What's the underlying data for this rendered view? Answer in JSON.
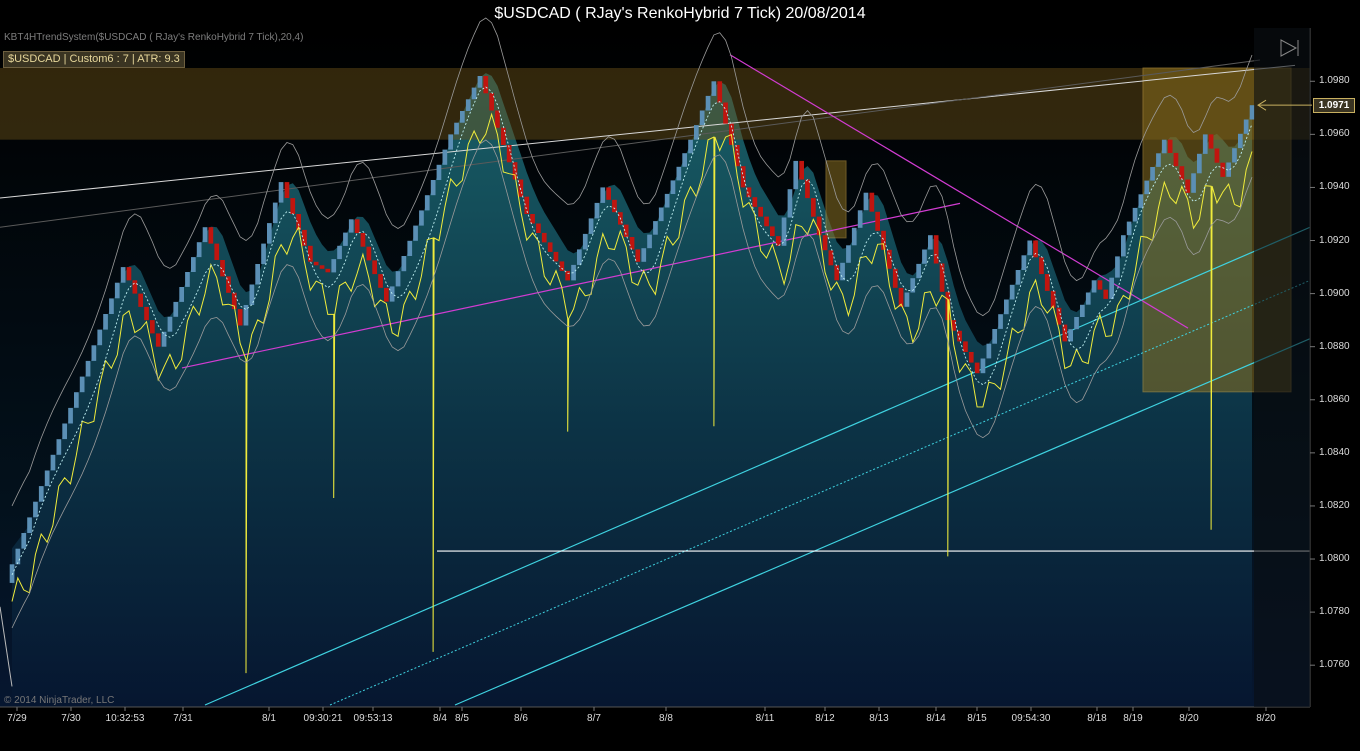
{
  "window": {
    "title": "$USDCAD ( RJay's RenkoHybrid  7 Tick)  20/08/2014"
  },
  "indicator_label": "KBT4HTrendSystem($USDCAD ( RJay's RenkoHybrid  7 Tick),20,4)",
  "info_box": "$USDCAD  |  Custom6 : 7  |  ATR: 9.3",
  "copyright": "© 2014 NinjaTrader, LLC",
  "colors": {
    "background": "#000000",
    "up_bar": "#5b8fb5",
    "down_bar": "#c0150f",
    "yellow_indicator": "#f0ec3c",
    "cyan_channel": "#3fd2e0",
    "magenta_trendline": "#d23cd2",
    "supply_zone": "#6e5418",
    "current_price_label": "#c8b060"
  },
  "icons": {
    "scroll_end": "triangle-right-bar-icon"
  },
  "chart_data": {
    "type": "renko",
    "symbol": "$USDCAD",
    "bar_type": "RJay's RenkoHybrid 7 Tick",
    "date": "20/08/2014",
    "current_price": 1.0971,
    "current_price_label": "1.0971",
    "ylim": [
      1.0745,
      1.0985
    ],
    "yticks": [
      "1.0980",
      "1.0960",
      "1.0940",
      "1.0920",
      "1.0900",
      "1.0880",
      "1.0860",
      "1.0840",
      "1.0820",
      "1.0800",
      "1.0780",
      "1.0760"
    ],
    "xticks": [
      "7/29",
      "7/30",
      "10:32:53",
      "7/31",
      "8/1",
      "09:30:21",
      "09:53:13",
      "8/4",
      "8/5",
      "8/6",
      "8/7",
      "8/8",
      "8/11",
      "8/12",
      "8/13",
      "8/14",
      "8/15",
      "09:54:30",
      "8/18",
      "8/19",
      "8/20",
      "8/20"
    ],
    "brick_size": 0.0007,
    "close_path": [
      [
        1.0798,
        1
      ],
      [
        1.091,
        19
      ],
      [
        1.088,
        6
      ],
      [
        1.0925,
        8
      ],
      [
        1.0888,
        6
      ],
      [
        1.0942,
        7
      ],
      [
        1.0912,
        5
      ],
      [
        1.0908,
        3
      ],
      [
        1.0928,
        4
      ],
      [
        1.0897,
        6
      ],
      [
        1.096,
        11
      ],
      [
        1.0982,
        5
      ],
      [
        1.093,
        8
      ],
      [
        1.0905,
        7
      ],
      [
        1.094,
        6
      ],
      [
        1.0912,
        6
      ],
      [
        1.0958,
        9
      ],
      [
        1.098,
        4
      ],
      [
        1.094,
        5
      ],
      [
        1.0918,
        6
      ],
      [
        1.095,
        3
      ],
      [
        1.0922,
        4
      ],
      [
        1.0905,
        3
      ],
      [
        1.0938,
        5
      ],
      [
        1.0895,
        6
      ],
      [
        1.0922,
        5
      ],
      [
        1.089,
        3
      ],
      [
        1.087,
        5
      ],
      [
        1.092,
        9
      ],
      [
        1.0882,
        6
      ],
      [
        1.0905,
        5
      ],
      [
        1.0898,
        2
      ],
      [
        1.0922,
        3
      ],
      [
        1.0958,
        7
      ],
      [
        1.0938,
        4
      ],
      [
        1.096,
        3
      ],
      [
        1.0944,
        3
      ],
      [
        1.0971,
        5
      ]
    ],
    "supply_zone": [
      1.0958,
      1.0985
    ],
    "horizontal_support": 1.0803,
    "annotations": [
      "upper-trendline",
      "magenta-rising-trendline",
      "magenta-falling-trendline",
      "cyan-channel-upper",
      "cyan-channel-mid",
      "cyan-channel-lower",
      "yellow-oscillator"
    ]
  }
}
